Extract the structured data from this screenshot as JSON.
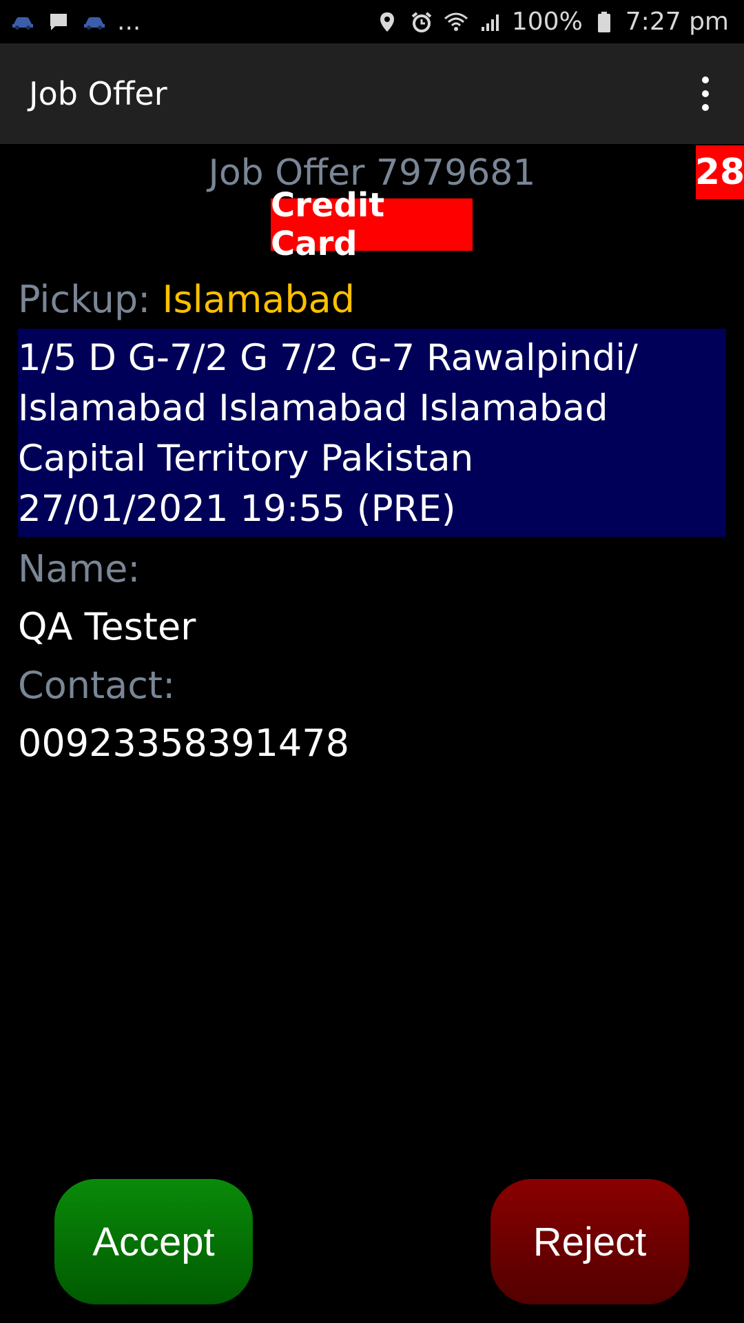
{
  "status_bar": {
    "icons_left": [
      "car-icon",
      "message-icon",
      "car-icon"
    ],
    "overflow": "...",
    "icons_right": [
      "location-icon",
      "alarm-icon",
      "wifi-icon",
      "signal-icon"
    ],
    "battery": "100%",
    "time": "7:27 pm"
  },
  "app_bar": {
    "title": "Job Offer",
    "menu_icon": "more-vert-icon"
  },
  "offer": {
    "title": "Job Offer 7979681",
    "timer": "28",
    "payment": "Credit Card",
    "pickup_label": "Pickup:",
    "pickup_city": "Islamabad",
    "address": "1/5 D G-7/2 G 7/2 G-7 Rawalpindi/\nIslamabad Islamabad Islamabad\nCapital Territory Pakistan\n27/01/2021 19:55 (PRE)",
    "name_label": "Name:",
    "name_value": "QA Tester",
    "contact_label": "Contact:",
    "contact_value": "00923358391478"
  },
  "actions": {
    "accept_label": "Accept",
    "reject_label": "Reject"
  },
  "colors": {
    "badge_red": "#ff0000",
    "pickup_yellow": "#ffc000",
    "address_bg": "#000058",
    "label_gray": "#7a8696",
    "accept_green": "#0a8a0a",
    "reject_red": "#8a0000"
  }
}
